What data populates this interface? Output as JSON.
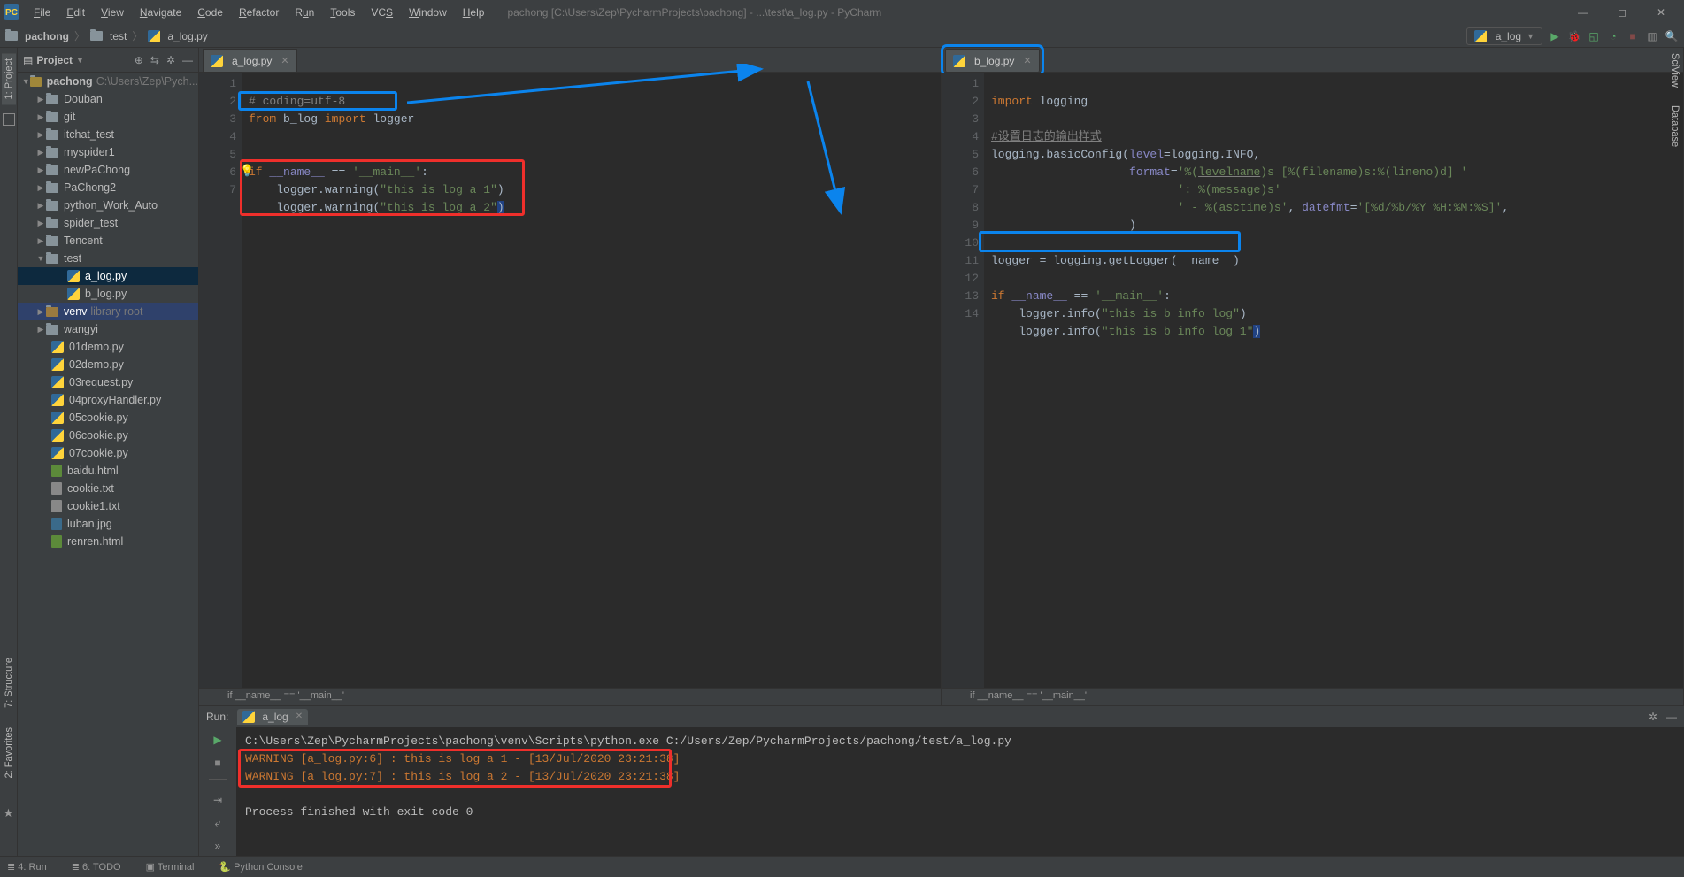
{
  "window": {
    "title_path": "pachong [C:\\Users\\Zep\\PycharmProjects\\pachong] - ...\\test\\a_log.py - PyCharm"
  },
  "menu": [
    "File",
    "Edit",
    "View",
    "Navigate",
    "Code",
    "Refactor",
    "Run",
    "Tools",
    "VCS",
    "Window",
    "Help"
  ],
  "breadcrumbs": {
    "root": "pachong",
    "dir": "test",
    "file": "a_log.py"
  },
  "run_config": "a_log",
  "project": {
    "title": "Project",
    "root": {
      "name": "pachong",
      "hint": "C:\\Users\\Zep\\Pych..."
    },
    "dirs": [
      "Douban",
      "git",
      "itchat_test",
      "myspider1",
      "newPaChong",
      "PaChong2",
      "python_Work_Auto",
      "spider_test",
      "Tencent"
    ],
    "test_dir": "test",
    "test_files": [
      "a_log.py",
      "b_log.py"
    ],
    "venv": {
      "name": "venv",
      "hint": "library root"
    },
    "more_dirs": [
      "wangyi"
    ],
    "files": [
      "01demo.py",
      "02demo.py",
      "03request.py",
      "04proxyHandler.py",
      "05cookie.py",
      "06cookie.py",
      "07cookie.py"
    ],
    "html_files": [
      "baidu.html"
    ],
    "txt_files": [
      "cookie.txt",
      "cookie1.txt"
    ],
    "img_files": [
      "luban.jpg"
    ],
    "more_html": [
      "renren.html"
    ]
  },
  "editor_left": {
    "tab": "a_log.py",
    "lines": [
      "1",
      "2",
      "3",
      "4",
      "5",
      "6",
      "7"
    ],
    "code": {
      "l1": "# coding=utf-8",
      "l2_from": "from",
      "l2_mod": "b_log",
      "l2_import": "import",
      "l2_name": "logger",
      "l5_if": "if",
      "l5_name": "__name__",
      "l5_eq": " == ",
      "l5_main": "'__main__'",
      "l5_colon": ":",
      "l6_obj": "logger",
      "l6_fn": ".warning(",
      "l6_str": "\"this is log a 1\"",
      "l6_close": ")",
      "l7_obj": "logger",
      "l7_fn": ".warning(",
      "l7_str": "\"this is log a 2\"",
      "l7_close": ")"
    },
    "crumb": "if __name__ == '__main__'"
  },
  "editor_right": {
    "tab": "b_log.py",
    "lines": [
      "1",
      "2",
      "3",
      "4",
      "5",
      "6",
      "7",
      "8",
      "9",
      "10",
      "11",
      "12",
      "13",
      "14"
    ],
    "code": {
      "l1_import": "import",
      "l1_mod": "logging",
      "l3": "#设置日志的输出样式",
      "l4a": "logging.basicConfig(",
      "l4b": "level",
      "l4c": "=logging.INFO,",
      "l5a": "format",
      "l5b": "=",
      "l5c": "'%(",
      "l5d": "levelname",
      "l5e": ")s [%(filename)s:%(lineno)d] '",
      "l6": "': %(message)s'",
      "l7a": "' - %(",
      "l7b": "asctime",
      "l7c": ")s'",
      "l7d": ", ",
      "l7e": "datefmt",
      "l7f": "=",
      "l7g": "'[%d/%b/%Y %H:%M:%S]'",
      "l7h": ",",
      "l8": ")",
      "l10": "logger = logging.getLogger(__name__)",
      "l12_if": "if",
      "l12_name": "__name__",
      "l12_eq": " == ",
      "l12_main": "'__main__'",
      "l12_colon": ":",
      "l13a": "logger.info(",
      "l13b": "\"this is b info log\"",
      "l13c": ")",
      "l14a": "logger.info(",
      "l14b": "\"this is b info log 1\"",
      "l14c": ")"
    },
    "crumb": "if __name__ == '__main__'"
  },
  "run": {
    "label": "Run:",
    "config": "a_log",
    "out1": "C:\\Users\\Zep\\PycharmProjects\\pachong\\venv\\Scripts\\python.exe C:/Users/Zep/PycharmProjects/pachong/test/a_log.py",
    "out2": "WARNING [a_log.py:6] :  this is log a 1 - [13/Jul/2020 23:21:38]",
    "out3": "WARNING [a_log.py:7] :  this is log a 2 - [13/Jul/2020 23:21:38]",
    "out4": "Process finished with exit code 0"
  },
  "side_left": [
    "1: Project",
    "7: Structure",
    "2: Favorites"
  ],
  "side_right": [
    "SciView",
    "Database"
  ],
  "status": {
    "left_items": [
      "≣ 4: Run",
      "≣ 6: TODO",
      "▣ Terminal",
      "🐍 Python Console"
    ]
  }
}
